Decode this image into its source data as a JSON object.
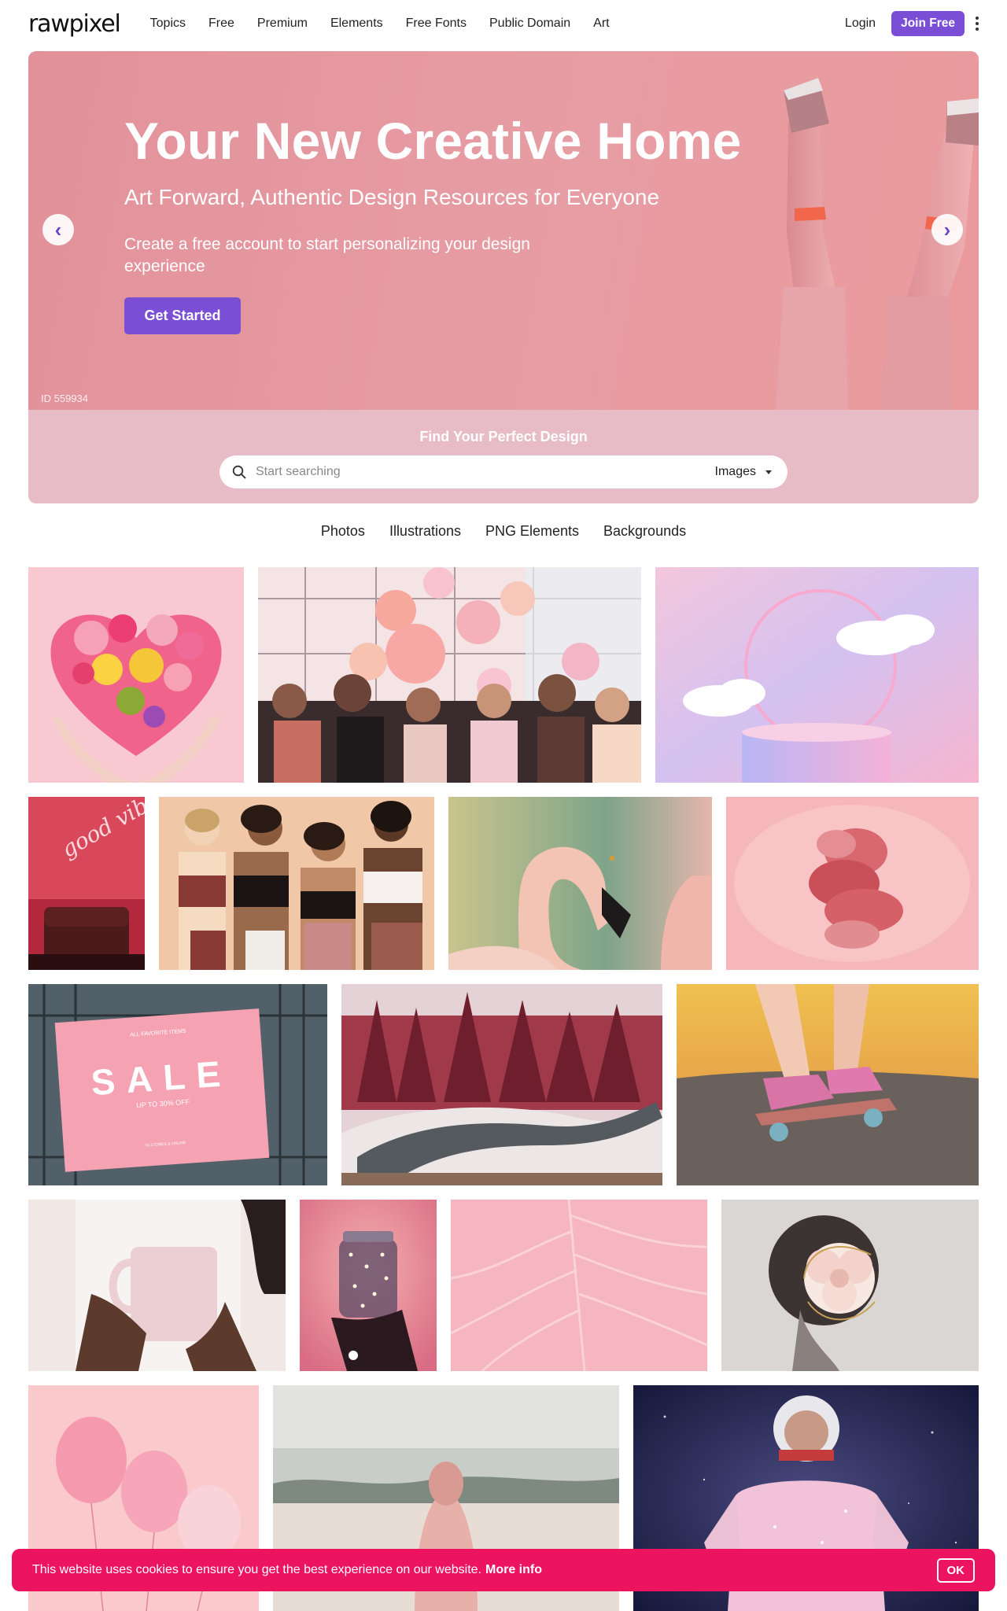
{
  "header": {
    "logo": "rawpixel",
    "nav": [
      "Topics",
      "Free",
      "Premium",
      "Elements",
      "Free Fonts",
      "Public Domain",
      "Art"
    ],
    "login": "Login",
    "join": "Join Free"
  },
  "hero": {
    "title": "Your New Creative Home",
    "subtitle": "Art Forward, Authentic Design Resources for Everyone",
    "text": "Create a free account to start personalizing your design experience",
    "cta": "Get Started",
    "image_id": "ID 559934",
    "prev_glyph": "‹",
    "next_glyph": "›"
  },
  "search": {
    "title": "Find Your Perfect Design",
    "placeholder": "Start searching",
    "type": "Images"
  },
  "tabs": [
    "Photos",
    "Illustrations",
    "PNG Elements",
    "Backgrounds"
  ],
  "gallery": {
    "tiles": [
      {
        "name": "flower-heart-hands-image"
      },
      {
        "name": "party-balloons-image"
      },
      {
        "name": "pastel-cloud-podium-image"
      },
      {
        "name": "good-vibes-neon-image",
        "text": "good vibes"
      },
      {
        "name": "women-laughing-image"
      },
      {
        "name": "flamingo-image"
      },
      {
        "name": "pink-smoke-image"
      },
      {
        "name": "sale-billboard-image",
        "small_top": "ALL FAVORITE ITEMS",
        "big": "SALE",
        "small_bottom": "UP TO 30% OFF",
        "footer": "IN STORES & ONLINE"
      },
      {
        "name": "forest-road-image"
      },
      {
        "name": "skateboard-sneakers-image"
      },
      {
        "name": "pink-mug-image"
      },
      {
        "name": "fairy-lights-jar-image"
      },
      {
        "name": "pink-leaf-texture-image"
      },
      {
        "name": "flower-portrait-image"
      },
      {
        "name": "pink-balloons-image"
      },
      {
        "name": "beach-woman-image"
      },
      {
        "name": "astronaut-image"
      }
    ]
  },
  "cookie": {
    "text": "This website uses cookies to ensure you get the best experience on our website.",
    "more": "More info",
    "ok": "OK"
  },
  "colors": {
    "accent": "#7a4fd6",
    "cookie_bg": "#ec145f",
    "hero_bg": "#e79da4",
    "search_band": "#e8bcc6"
  }
}
